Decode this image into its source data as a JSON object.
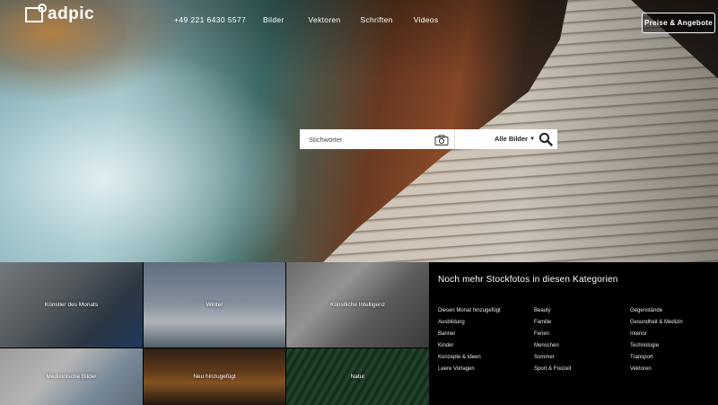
{
  "header": {
    "logo_text": "adpic",
    "phone": "+49 221 6430 5577",
    "nav": [
      "Bilder",
      "Vektoren",
      "Schriften",
      "Videos"
    ],
    "cta": "Preise & Angebote"
  },
  "search": {
    "placeholder": "Stichwörter",
    "filter": "Alle Bilder"
  },
  "tiles": [
    "Künstler des Monats",
    "Winter",
    "Künstliche Intelligenz",
    "Medizinische Bilder",
    "Neu hinzugefügt",
    "Natur"
  ],
  "categories": {
    "title": "Noch mehr Stockfotos in diesen Kategorien",
    "col1": [
      "Diesen Monat hinzugefügt",
      "Ausbildung",
      "Banner",
      "Kinder",
      "Konzepte & Ideen",
      "Leere Vorlagen"
    ],
    "col2": [
      "Beauty",
      "Familie",
      "Ferien",
      "Menschen",
      "Sommer",
      "Sport & Freizeit"
    ],
    "col3": [
      "Gegenstände",
      "Gesundheit & Medizin",
      "Interior",
      "Technologie",
      "Transport",
      "Vektoren"
    ]
  },
  "colors": {
    "background": "#000000",
    "text": "#ffffff"
  }
}
